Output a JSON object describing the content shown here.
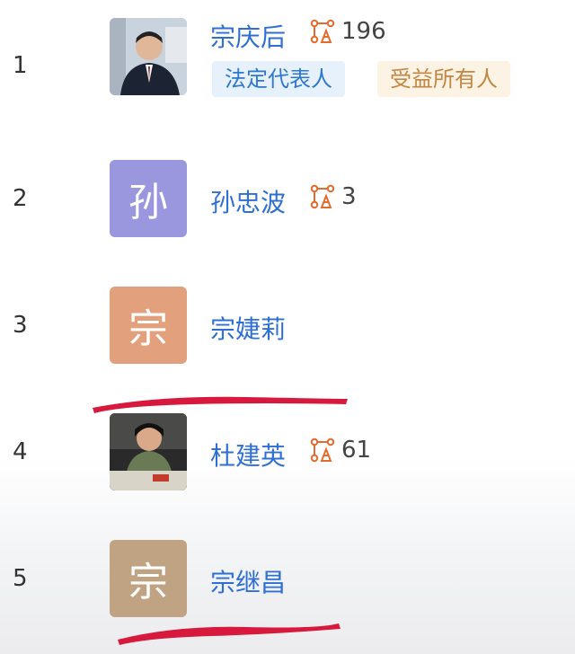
{
  "people": [
    {
      "rank": "1",
      "name": "宗庆后",
      "count": "196",
      "tags": [
        "法定代表人",
        "受益所有人"
      ]
    },
    {
      "rank": "2",
      "name": "孙忠波",
      "count": "3",
      "avatar_char": "孙",
      "avatar_color": "#9b97de"
    },
    {
      "rank": "3",
      "name": "宗婕莉",
      "avatar_char": "宗",
      "avatar_color": "#e2a07c"
    },
    {
      "rank": "4",
      "name": "杜建英",
      "count": "61"
    },
    {
      "rank": "5",
      "name": "宗继昌",
      "avatar_char": "宗",
      "avatar_color": "#c0a383"
    }
  ],
  "colors": {
    "link": "#2d6fd6",
    "icon": "#e46b2e",
    "highlight": "#d6193c"
  },
  "icons": {
    "relation": "relation-company-icon"
  }
}
